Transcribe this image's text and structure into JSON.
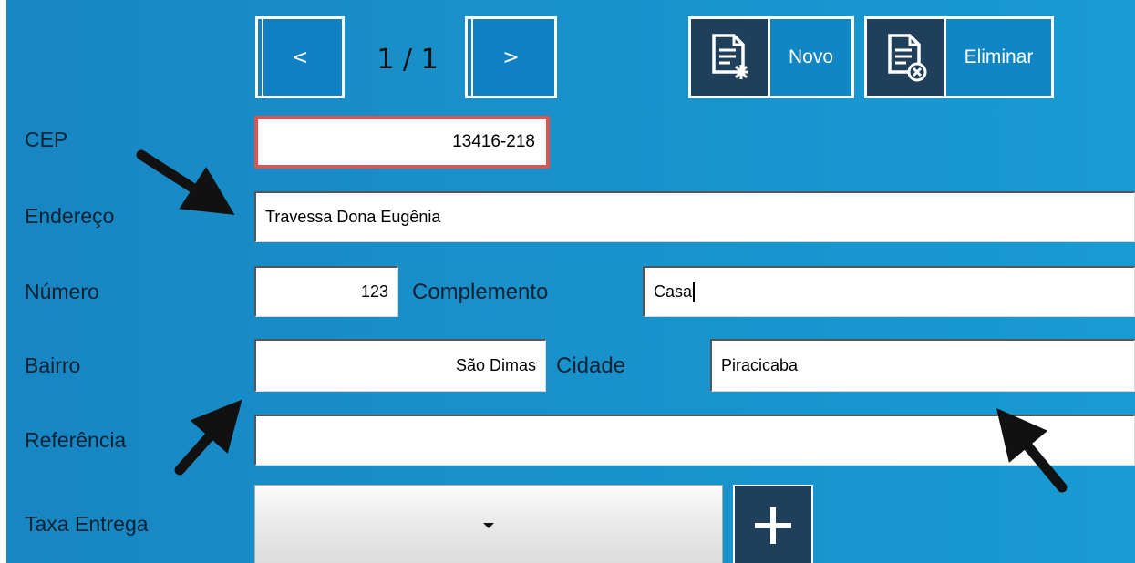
{
  "pager": {
    "prev_label": "<",
    "next_label": ">",
    "position": "1 / 1"
  },
  "actions": {
    "new_label": "Novo",
    "new_icon": "document-new-icon",
    "delete_label": "Eliminar",
    "delete_icon": "document-delete-icon"
  },
  "form": {
    "cep": {
      "label": "CEP",
      "value": "13416-218"
    },
    "endereco": {
      "label": "Endereço",
      "value": "Travessa Dona Eugênia"
    },
    "numero": {
      "label": "Número",
      "value": "123"
    },
    "complemento": {
      "label": "Complemento",
      "value": "Casa"
    },
    "bairro": {
      "label": "Bairro",
      "value": "São Dimas"
    },
    "cidade": {
      "label": "Cidade",
      "value": "Piracicaba"
    },
    "referencia": {
      "label": "Referência",
      "value": ""
    },
    "taxa_entrega": {
      "label": "Taxa Entrega",
      "value": ""
    }
  },
  "colors": {
    "background": "#1a8fc9",
    "cep_highlight": "#e0524c",
    "dark_button": "#1f3f5b",
    "annotation_arrow": "#111111"
  },
  "annotations": [
    "arrow-to-endereco",
    "arrow-to-bairro",
    "arrow-to-cidade"
  ]
}
